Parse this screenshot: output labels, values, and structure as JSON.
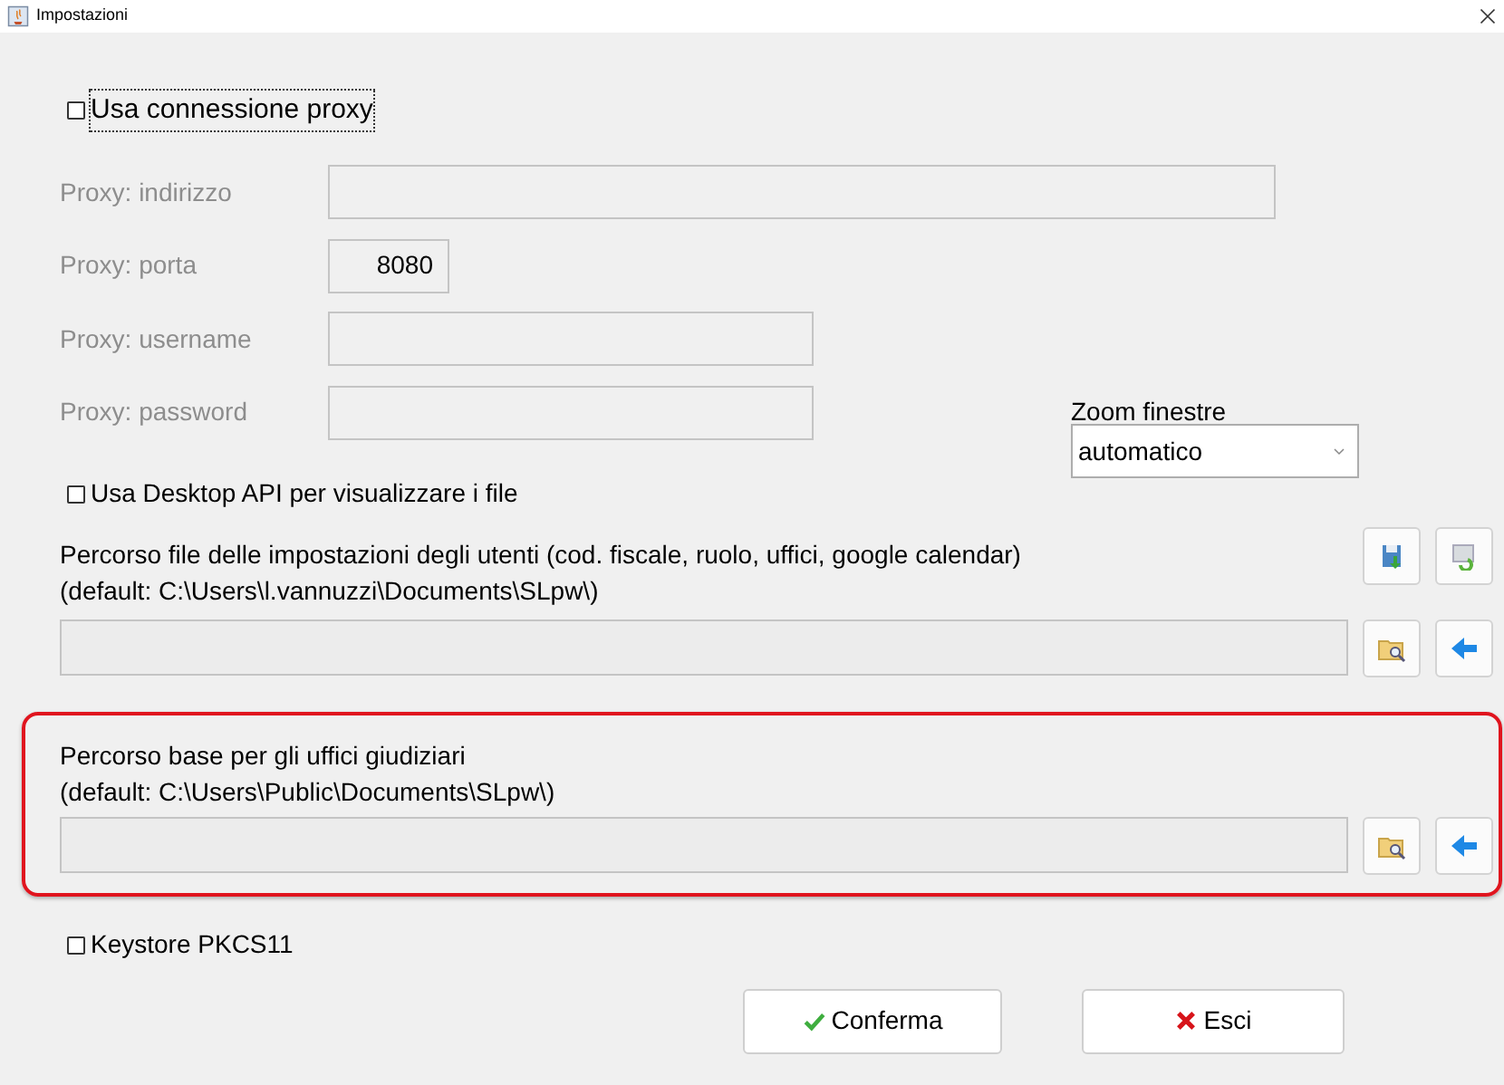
{
  "window": {
    "title": "Impostazioni"
  },
  "proxy": {
    "checkbox": {
      "label": "Usa connessione proxy",
      "checked": false,
      "focused": true
    },
    "fields": [
      {
        "label": "Proxy: indirizzo",
        "kind": "wide",
        "disabled": true
      },
      {
        "label": "Proxy: porta",
        "kind": "port",
        "value": "8080",
        "disabled": true
      },
      {
        "label": "Proxy: username",
        "kind": "medium",
        "disabled": true
      },
      {
        "label": "Proxy: password",
        "kind": "medium",
        "disabled": true
      }
    ]
  },
  "zoom": {
    "label": "Zoom finestre",
    "value": "automatico"
  },
  "desktop_api": {
    "label": "Usa Desktop API per visualizzare i file",
    "checked": false
  },
  "paths": [
    {
      "title": "Percorso file delle impostazioni degli utenti (cod. fiscale, ruolo, uffici, google calendar)",
      "default": "(default: C:\\Users\\l.vannuzzi\\Documents\\SLpw\\)",
      "highlighted": false,
      "extra_buttons": true
    },
    {
      "title": "Percorso base per gli uffici giudiziari",
      "default": "(default: C:\\Users\\Public\\Documents\\SLpw\\)",
      "highlighted": true,
      "extra_buttons": false
    }
  ],
  "keystore": {
    "label": "Keystore PKCS11",
    "checked": false
  },
  "buttons": [
    {
      "label": "Conferma",
      "kind": "confirm"
    },
    {
      "label": "Esci",
      "kind": "exit"
    }
  ]
}
